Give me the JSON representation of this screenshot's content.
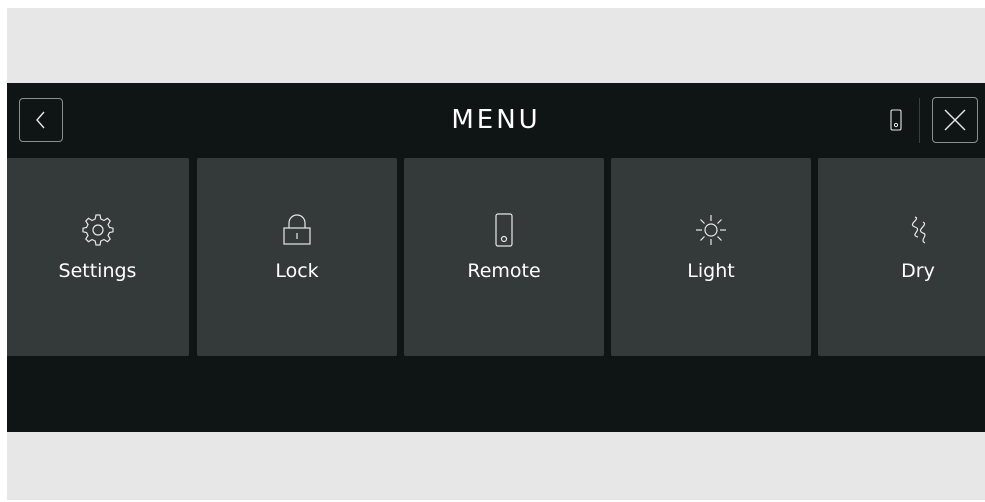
{
  "header": {
    "title": "MENU",
    "back_icon": "chevron-left-icon",
    "remote_indicator_icon": "remote-icon",
    "close_icon": "close-icon"
  },
  "tiles": [
    {
      "label": "Settings",
      "icon": "gear-icon"
    },
    {
      "label": "Lock",
      "icon": "lock-icon"
    },
    {
      "label": "Remote",
      "icon": "remote-icon"
    },
    {
      "label": "Light",
      "icon": "light-icon"
    },
    {
      "label": "Dry",
      "icon": "dry-icon"
    }
  ],
  "colors": {
    "panel": "#0f1414",
    "tile": "#343a3a",
    "frame": "#e6e7e6",
    "text": "#ffffff"
  }
}
